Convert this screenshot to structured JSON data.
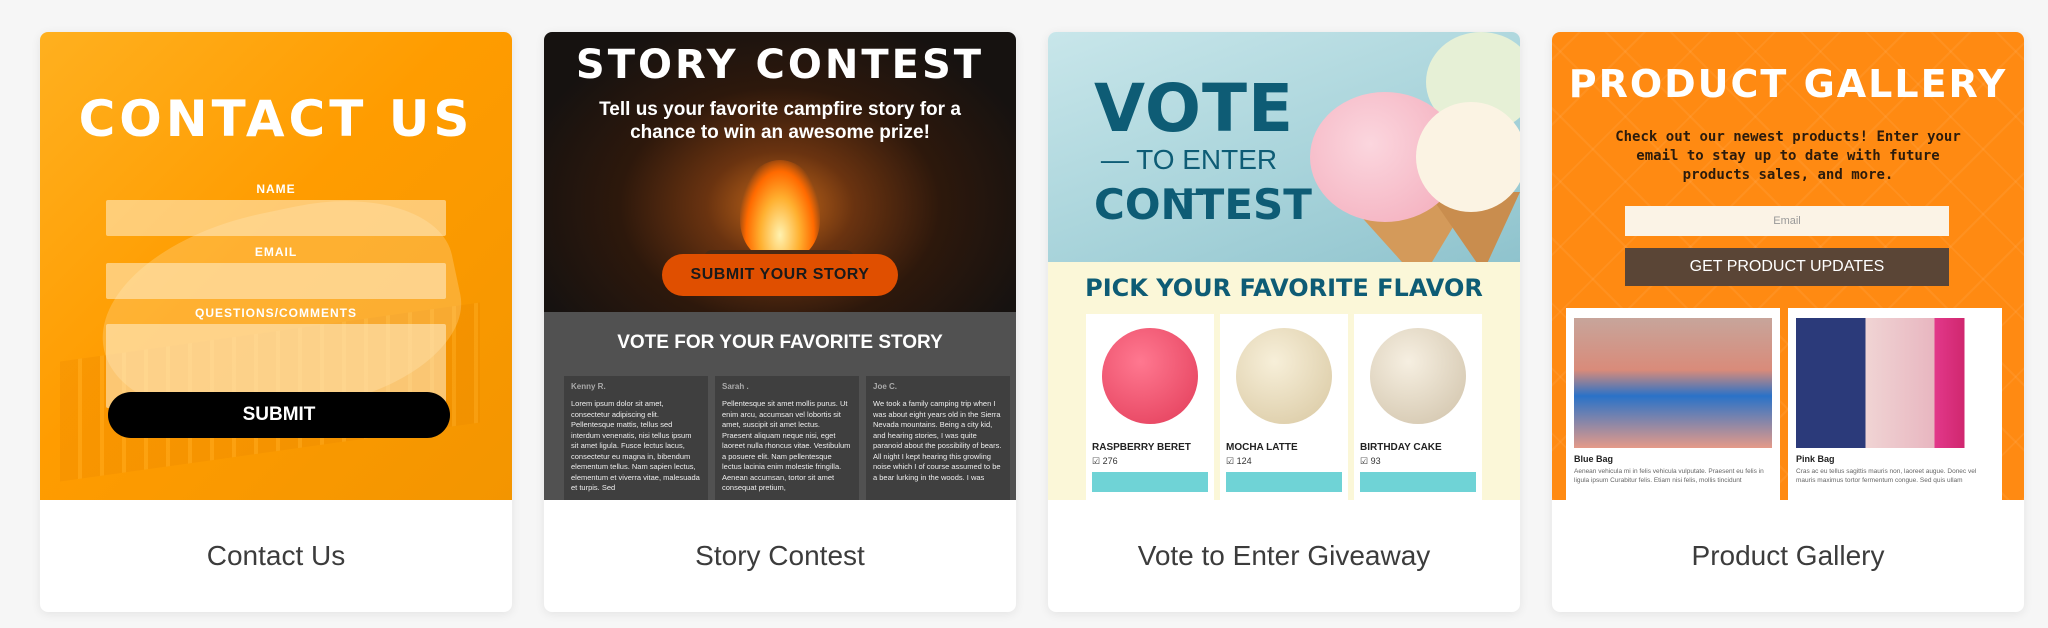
{
  "cards": [
    {
      "caption": "Contact Us",
      "title": "CONTACT US",
      "fields": [
        "NAME",
        "EMAIL",
        "QUESTIONS/COMMENTS"
      ],
      "button": "SUBMIT",
      "color": "#ff9c00"
    },
    {
      "caption": "Story Contest",
      "title": "STORY CONTEST",
      "subtitle": "Tell us your favorite campfire story for a chance to win an awesome prize!",
      "button": "SUBMIT YOUR STORY",
      "vote_heading": "VOTE FOR YOUR FAVORITE STORY",
      "stories": [
        {
          "author": "Kenny R.",
          "text": "Lorem ipsum dolor sit amet, consectetur adipiscing elit. Pellentesque mattis, tellus sed interdum venenatis, nisi tellus ipsum sit amet ligula. Fusce lectus lacus, consectetur eu magna in, bibendum elementum tellus. Nam sapien lectus, elementum et viverra vitae, malesuada et turpis. Sed"
        },
        {
          "author": "Sarah .",
          "text": "Pellentesque sit amet mollis purus. Ut enim arcu, accumsan vel lobortis sit amet, suscipit sit amet lectus. Praesent aliquam neque nisi, eget laoreet nulla rhoncus vitae. Vestibulum a posuere elit. Nam pellentesque lectus lacinia enim molestie fringilla. Aenean accumsan, tortor sit amet consequat pretium,"
        },
        {
          "author": "Joe C.",
          "text": "We took a family camping trip when I was about eight years old in the Sierra Nevada mountains. Being a city kid, and hearing stories, I was quite paranoid about the possibility of bears. All night I kept hearing this growling noise which I of course assumed to be a bear lurking in the woods. I was"
        }
      ]
    },
    {
      "caption": "Vote to Enter Giveaway",
      "title_vote": "VOTE",
      "title_to_enter": "— TO ENTER —",
      "title_contest": "CONTEST",
      "pick_heading": "PICK YOUR FAVORITE FLAVOR",
      "flavors": [
        {
          "name": "RASPBERRY BERET",
          "votes": "☑ 276",
          "color": "#f0506a"
        },
        {
          "name": "MOCHA LATTE",
          "votes": "☑ 124",
          "color": "#ece0c4"
        },
        {
          "name": "BIRTHDAY CAKE",
          "votes": "☑ 93",
          "color": "#ebe3cf"
        }
      ]
    },
    {
      "caption": "Product Gallery",
      "title": "PRODUCT GALLERY",
      "subtitle": "Check out our newest products! Enter your email to stay up to date with future products sales, and more.",
      "email_placeholder": "Email",
      "button": "GET PRODUCT UPDATES",
      "products": [
        {
          "name": "Blue Bag",
          "desc": "Aenean vehicula mi in felis vehicula vulputate. Praesent eu felis in ligula ipsum Curabitur felis. Etiam nisi felis, mollis tincidunt"
        },
        {
          "name": "Pink Bag",
          "desc": "Cras ac eu tellus sagittis mauris non, laoreet augue. Donec vel mauris maximus tortor fermentum congue. Sed quis ullam"
        }
      ]
    }
  ]
}
